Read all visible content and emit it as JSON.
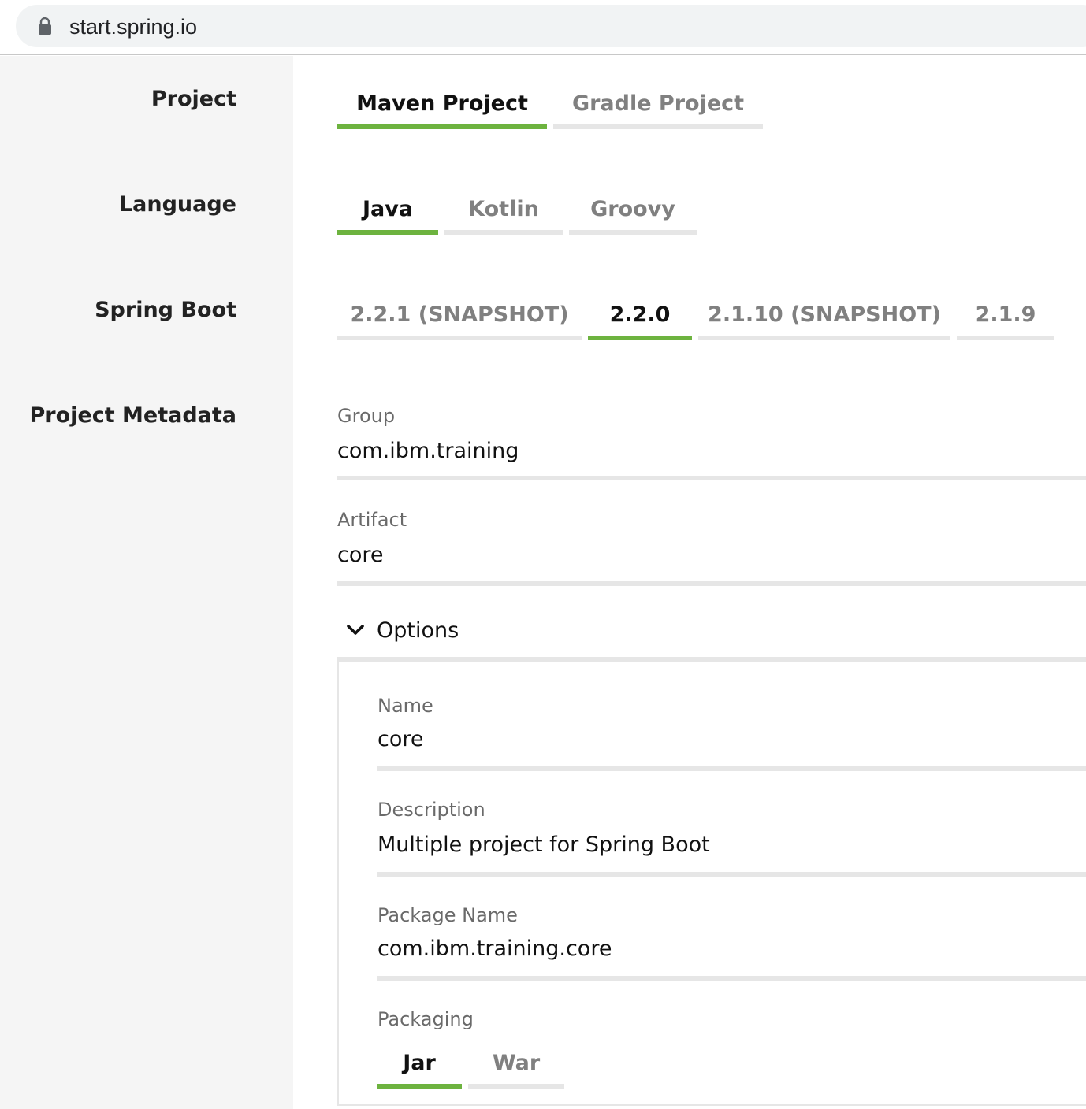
{
  "browser": {
    "url": "start.spring.io"
  },
  "sections": {
    "project": "Project",
    "language": "Language",
    "spring_boot": "Spring Boot",
    "metadata": "Project Metadata"
  },
  "project_tabs": [
    "Maven Project",
    "Gradle Project"
  ],
  "project_selected": "Maven Project",
  "language_tabs": [
    "Java",
    "Kotlin",
    "Groovy"
  ],
  "language_selected": "Java",
  "boot_tabs": [
    "2.2.1 (SNAPSHOT)",
    "2.2.0",
    "2.1.10 (SNAPSHOT)",
    "2.1.9"
  ],
  "boot_selected": "2.2.0",
  "metadata": {
    "group": {
      "label": "Group",
      "value": "com.ibm.training"
    },
    "artifact": {
      "label": "Artifact",
      "value": "core"
    },
    "options_label": "Options",
    "name": {
      "label": "Name",
      "value": "core"
    },
    "description": {
      "label": "Description",
      "value": "Multiple project for Spring Boot"
    },
    "package_name": {
      "label": "Package Name",
      "value": "com.ibm.training.core"
    },
    "packaging": {
      "label": "Packaging",
      "tabs": [
        "Jar",
        "War"
      ],
      "selected": "Jar"
    }
  },
  "colors": {
    "accent": "#6db33f",
    "inactive_line": "#e6e6e6",
    "sidebar_bg": "#f5f5f5"
  },
  "icons": {
    "lock": "lock-icon",
    "chevron": "chevron-down-icon"
  }
}
